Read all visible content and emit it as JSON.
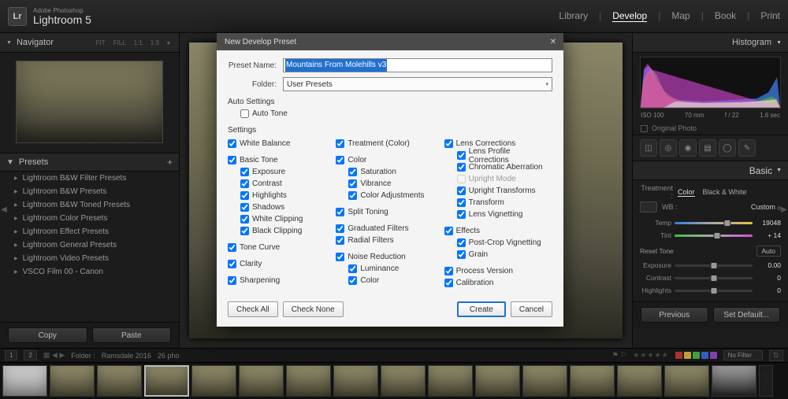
{
  "app": {
    "subtitle": "Adobe Photoshop",
    "title": "Lightroom 5",
    "logo": "Lr"
  },
  "topnav": {
    "library": "Library",
    "develop": "Develop",
    "map": "Map",
    "book": "Book",
    "print": "Print"
  },
  "navigator": {
    "title": "Navigator",
    "fit": "FIT",
    "fill": "FILL",
    "z1": "1:1",
    "z2": "1:3"
  },
  "presets": {
    "title": "Presets",
    "items": [
      "Lightroom B&W Filter Presets",
      "Lightroom B&W Presets",
      "Lightroom B&W Toned Presets",
      "Lightroom Color Presets",
      "Lightroom Effect Presets",
      "Lightroom General Presets",
      "Lightroom Video Presets",
      "VSCO Film 00 - Canon"
    ],
    "copy": "Copy",
    "paste": "Paste"
  },
  "status": {
    "g1": "1",
    "g2": "2",
    "folder_lbl": "Folder :",
    "folder": "Ramsdale 2016",
    "count": "26 pho",
    "nofilter": "No Filter"
  },
  "right": {
    "histogram": "Histogram",
    "iso": "ISO 100",
    "focal": "70 mm",
    "aperture": "f / 22",
    "shutter": "1.6 sec",
    "original": "Original Photo",
    "basic": "Basic",
    "treatment_lbl": "Treatment :",
    "color": "Color",
    "bw": "Black & White",
    "wb_lbl": "WB :",
    "wb_val": "Custom",
    "temp_lbl": "Temp",
    "temp_val": "19048",
    "tint_lbl": "Tint",
    "tint_val": "+ 14",
    "reset": "Reset Tone",
    "auto": "Auto",
    "exposure_lbl": "Exposure",
    "exposure_val": "0.00",
    "contrast_lbl": "Contrast",
    "contrast_val": "0",
    "highlights_lbl": "Highlights",
    "highlights_val": "0",
    "previous": "Previous",
    "setdefault": "Set Default..."
  },
  "dialog": {
    "title": "New Develop Preset",
    "preset_name_lbl": "Preset Name:",
    "preset_name": "Mountains From Molehills v3",
    "folder_lbl": "Folder:",
    "folder": "User Presets",
    "auto_settings": "Auto Settings",
    "auto_tone": "Auto Tone",
    "settings": "Settings",
    "col1": {
      "white_balance": "White Balance",
      "basic_tone": "Basic Tone",
      "exposure": "Exposure",
      "contrast": "Contrast",
      "highlights": "Highlights",
      "shadows": "Shadows",
      "white_clip": "White Clipping",
      "black_clip": "Black Clipping",
      "tone_curve": "Tone Curve",
      "clarity": "Clarity",
      "sharpening": "Sharpening"
    },
    "col2": {
      "treatment": "Treatment (Color)",
      "color": "Color",
      "saturation": "Saturation",
      "vibrance": "Vibrance",
      "color_adj": "Color Adjustments",
      "split_toning": "Split Toning",
      "grad_filters": "Graduated Filters",
      "radial_filters": "Radial Filters",
      "noise": "Noise Reduction",
      "luminance": "Luminance",
      "ncolor": "Color"
    },
    "col3": {
      "lens_corr": "Lens Corrections",
      "lens_profile": "Lens Profile Corrections",
      "chrom": "Chromatic Aberration",
      "upright_mode": "Upright Mode",
      "upright_trans": "Upright Transforms",
      "transform": "Transform",
      "lens_vig": "Lens Vignetting",
      "effects": "Effects",
      "postcrop": "Post-Crop Vignetting",
      "grain": "Grain",
      "process": "Process Version",
      "calibration": "Calibration"
    },
    "check_all": "Check All",
    "check_none": "Check None",
    "create": "Create",
    "cancel": "Cancel"
  }
}
